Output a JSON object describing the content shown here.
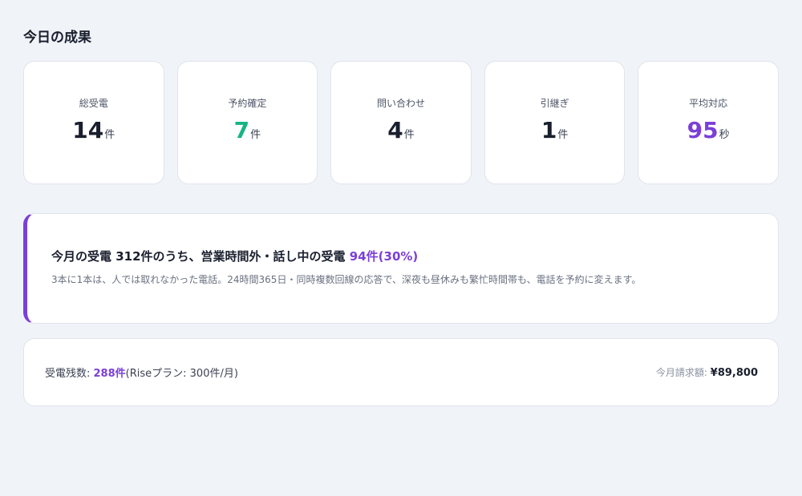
{
  "section": {
    "title": "今日の成果"
  },
  "stats": [
    {
      "label": "総受電",
      "value": "14",
      "unit": "件",
      "color": "#1a1f2e"
    },
    {
      "label": "予約確定",
      "value": "7",
      "unit": "件",
      "color": "#17b384"
    },
    {
      "label": "問い合わせ",
      "value": "4",
      "unit": "件",
      "color": "#1a1f2e"
    },
    {
      "label": "引継ぎ",
      "value": "1",
      "unit": "件",
      "color": "#1a1f2e"
    },
    {
      "label": "平均対応",
      "value": "95",
      "unit": "秒",
      "color": "#7b3fd8"
    }
  ],
  "callout": {
    "headline": "今月の受電 312件のうち、営業時間外・話し中の受電",
    "highlight": "94件(30%)",
    "description": "3本に1本は、人では取れなかった電話。24時間365日・同時複数回線の応答で、深夜も昼休みも繁忙時間帯も、電話を予約に変えます。",
    "accent_color": "#7b3fd8"
  },
  "usage": {
    "remaining_label": "受電残数: ",
    "remaining_value": "288件",
    "plan_text": "(Riseプラン: 300件/月)",
    "billing_label": "今月請求額: ",
    "billing_amount": "¥89,800"
  }
}
